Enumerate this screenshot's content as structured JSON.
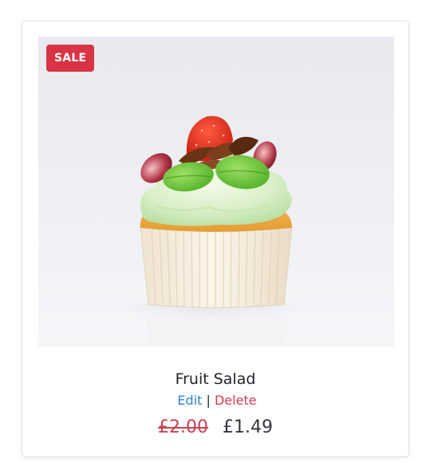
{
  "product": {
    "badge": "SALE",
    "title": "Fruit Salad",
    "image_alt": "cupcake with green frosting, strawberry, grapes and chocolate shavings",
    "actions": {
      "edit_label": "Edit",
      "separator": "|",
      "delete_label": "Delete"
    },
    "price": {
      "original": "£2.00",
      "sale": "£1.49"
    }
  },
  "colors": {
    "badge_bg": "#d93445",
    "edit_link": "#2f7fd9",
    "delete_link": "#d13b4c",
    "old_price": "#c94152"
  }
}
